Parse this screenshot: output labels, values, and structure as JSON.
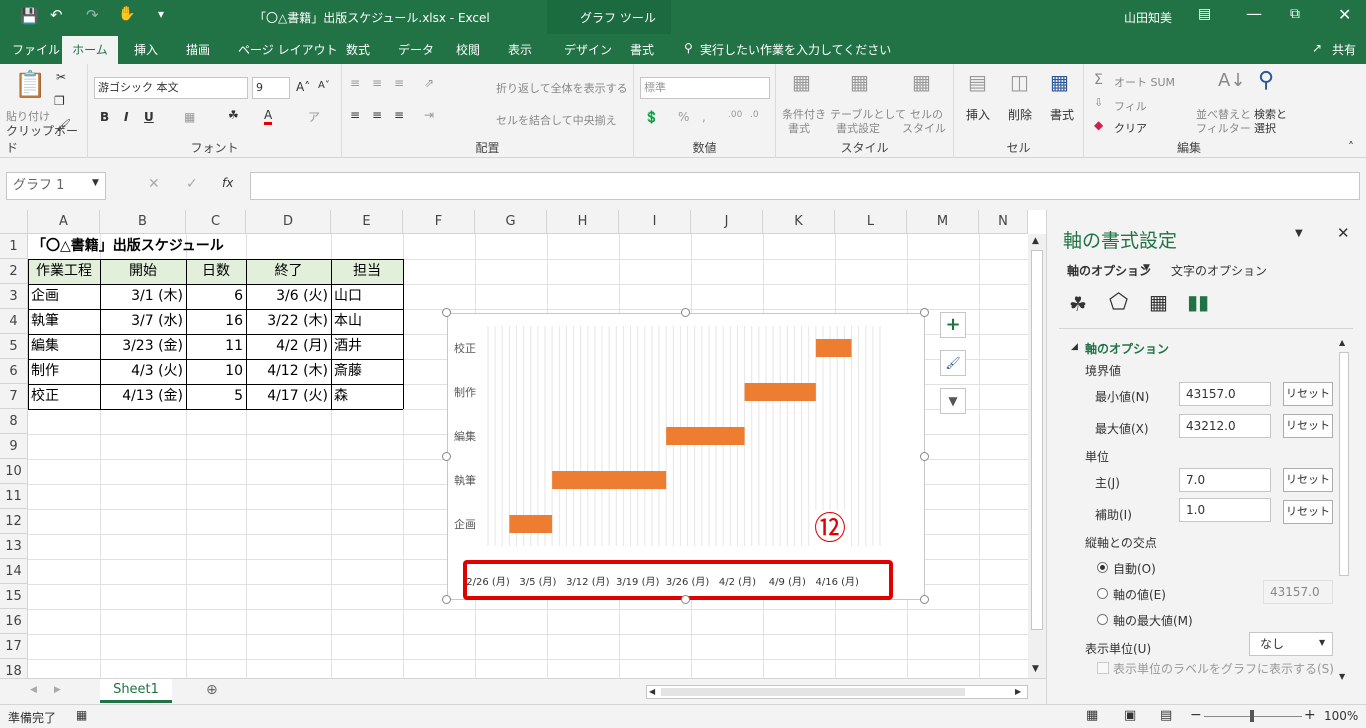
{
  "titlebar": {
    "title": "「〇△書籍」出版スケジュール.xlsx  -  Excel",
    "context": "グラフ ツール",
    "user": "山田知美"
  },
  "tabs": [
    "ファイル",
    "ホーム",
    "挿入",
    "描画",
    "ページ レイアウト",
    "数式",
    "データ",
    "校閲",
    "表示",
    "デザイン",
    "書式"
  ],
  "tell_me": "実行したい作業を入力してください",
  "share": "共有",
  "ribbon": {
    "clipboard": {
      "label": "クリップボード",
      "paste": "貼り付け"
    },
    "font": {
      "label": "フォント",
      "name": "游ゴシック 本文",
      "size": "9"
    },
    "alignment": {
      "label": "配置",
      "wrap": "折り返して全体を表示する",
      "merge": "セルを結合して中央揃え"
    },
    "number": {
      "label": "数値",
      "format": "標準"
    },
    "styles": {
      "label": "スタイル",
      "cond1": "条件付き",
      "cond2": "書式",
      "table1": "テーブルとして",
      "table2": "書式設定",
      "cell1": "セルの",
      "cell2": "スタイル"
    },
    "cells": {
      "label": "セル",
      "insert": "挿入",
      "delete": "削除",
      "format": "書式"
    },
    "editing": {
      "label": "編集",
      "autosum": "オート SUM",
      "fill": "フィル",
      "clear": "クリア",
      "sort1": "並べ替えと",
      "sort2": "フィルター",
      "find1": "検索と",
      "find2": "選択"
    }
  },
  "namebox": "グラフ 1",
  "fx": "fx",
  "columns": [
    "A",
    "B",
    "C",
    "D",
    "E",
    "F",
    "G",
    "H",
    "I",
    "J",
    "K",
    "L",
    "M",
    "N"
  ],
  "rows": [
    "1",
    "2",
    "3",
    "4",
    "5",
    "6",
    "7",
    "8",
    "9",
    "10",
    "11",
    "12",
    "13",
    "14",
    "15",
    "16",
    "17",
    "18"
  ],
  "sheet_title": "「〇△書籍」出版スケジュール",
  "table": {
    "headers": [
      "作業工程",
      "開始",
      "日数",
      "終了",
      "担当"
    ],
    "rows": [
      [
        "企画",
        "3/1 (木)",
        "6",
        "3/6 (火)",
        "山口"
      ],
      [
        "執筆",
        "3/7 (水)",
        "16",
        "3/22 (木)",
        "本山"
      ],
      [
        "編集",
        "3/23 (金)",
        "11",
        "4/2 (月)",
        "酒井"
      ],
      [
        "制作",
        "4/3 (火)",
        "10",
        "4/12 (木)",
        "斎藤"
      ],
      [
        "校正",
        "4/13 (金)",
        "5",
        "4/17 (火)",
        "森"
      ]
    ]
  },
  "chart_data": {
    "type": "bar",
    "orientation": "horizontal-stacked-gantt",
    "categories": [
      "企画",
      "執筆",
      "編集",
      "制作",
      "校正"
    ],
    "start_serial": [
      43160,
      43166,
      43182,
      43193,
      43203
    ],
    "duration": [
      6,
      16,
      11,
      10,
      5
    ],
    "xlim": [
      43157,
      43212
    ],
    "x_tick_labels": [
      "2/26 (月)",
      "3/5 (月)",
      "3/12 (月)",
      "3/19 (月)",
      "3/26 (月)",
      "4/2 (月)",
      "4/9 (月)",
      "4/16 (月)"
    ],
    "bar_color": "#ED7D31",
    "highlight_color": "#E00000",
    "grid": true
  },
  "annotation": "⑫",
  "sheet_tab": "Sheet1",
  "status": "準備完了",
  "zoom": "100%",
  "pane": {
    "title": "軸の書式設定",
    "tab_axis": "軸のオプション",
    "tab_text": "文字のオプション",
    "section": "軸のオプション",
    "bounds": "境界値",
    "min_label": "最小値(N)",
    "min_value": "43157.0",
    "max_label": "最大値(X)",
    "max_value": "43212.0",
    "reset": "リセット",
    "units": "単位",
    "major_label": "主(J)",
    "major_value": "7.0",
    "minor_label": "補助(I)",
    "minor_value": "1.0",
    "cross": "縦軸との交点",
    "auto": "自動(O)",
    "axis_value": "軸の値(E)",
    "axis_value_num": "43157.0",
    "axis_max": "軸の最大値(M)",
    "display_unit": "表示単位(U)",
    "display_unit_value": "なし",
    "show_label": "表示単位のラベルをグラフに表示する(S)"
  }
}
